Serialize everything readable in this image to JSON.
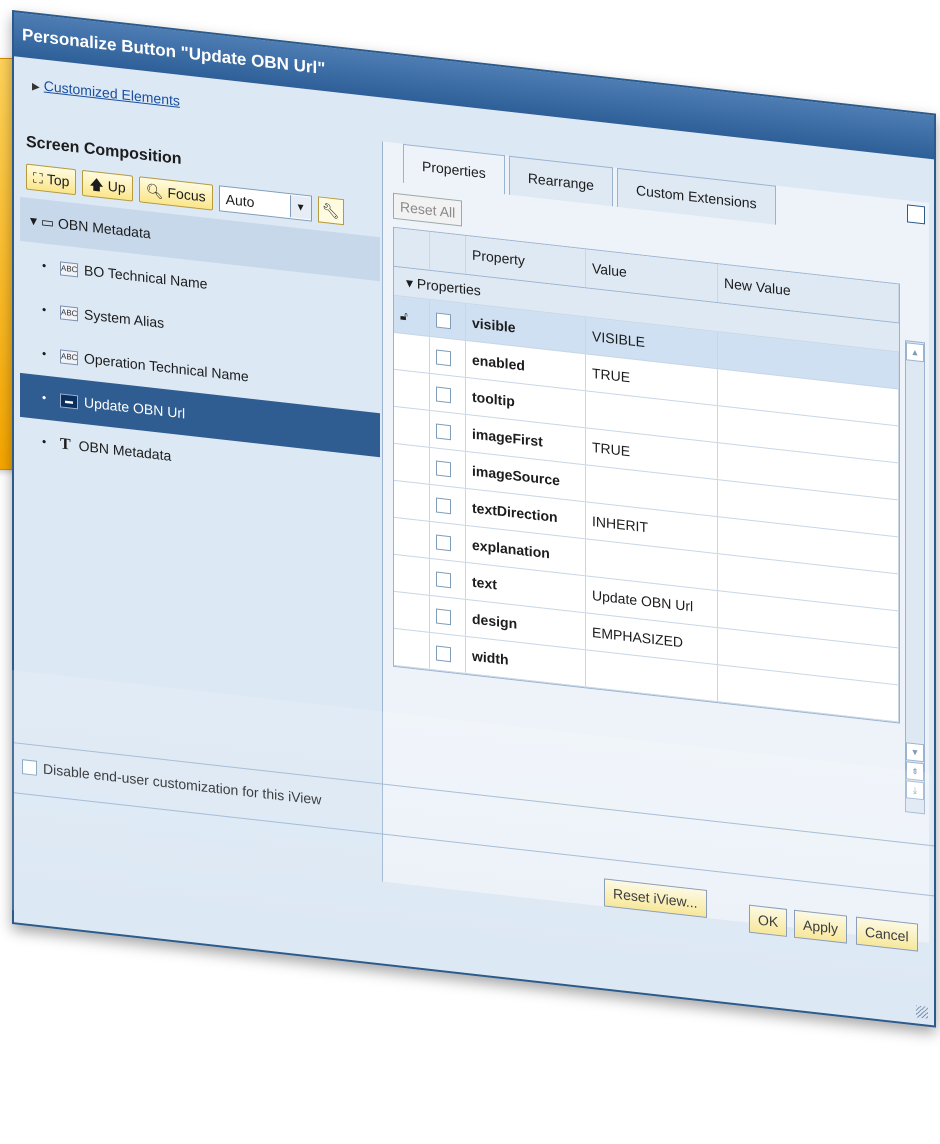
{
  "dialog": {
    "title": "Personalize Button \"Update OBN Url\"",
    "customized_link": "Customized Elements"
  },
  "left": {
    "section_title": "Screen Composition",
    "toolbar": {
      "top_label": "Top",
      "up_label": "Up",
      "focus_label": "Focus",
      "auto_value": "Auto"
    },
    "tree": [
      {
        "label": "OBN Metadata",
        "icon": "folder-icon"
      },
      {
        "label": "BO Technical Name",
        "icon": "abc-field-icon"
      },
      {
        "label": "System Alias",
        "icon": "abc-field-icon"
      },
      {
        "label": "Operation Technical Name",
        "icon": "abc-field-icon"
      },
      {
        "label": "Update OBN Url",
        "icon": "button-icon"
      },
      {
        "label": "OBN Metadata",
        "icon": "text-icon"
      }
    ]
  },
  "right": {
    "tabs": [
      "Properties",
      "Rearrange",
      "Custom Extensions"
    ],
    "reset_all": "Reset All",
    "columns": [
      "Property",
      "Value",
      "New Value"
    ],
    "group": "Properties",
    "rows": [
      {
        "property": "visible",
        "value": "VISIBLE"
      },
      {
        "property": "enabled",
        "value": "TRUE"
      },
      {
        "property": "tooltip",
        "value": ""
      },
      {
        "property": "imageFirst",
        "value": "TRUE"
      },
      {
        "property": "imageSource",
        "value": ""
      },
      {
        "property": "textDirection",
        "value": "INHERIT"
      },
      {
        "property": "explanation",
        "value": ""
      },
      {
        "property": "text",
        "value": "Update OBN Url"
      },
      {
        "property": "design",
        "value": "EMPHASIZED"
      },
      {
        "property": "width",
        "value": ""
      }
    ]
  },
  "footer": {
    "disable_checkbox": "Disable end-user customization for this iView",
    "reset_iview": "Reset iView...",
    "ok": "OK",
    "apply": "Apply",
    "cancel": "Cancel"
  }
}
